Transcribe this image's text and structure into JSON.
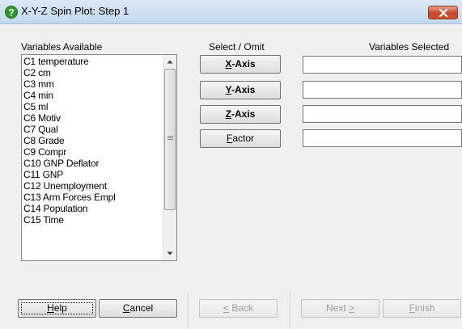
{
  "window": {
    "title": "X-Y-Z Spin Plot: Step 1",
    "icon": "help-question-icon",
    "close_icon": "close-icon"
  },
  "labels": {
    "variables_available": "Variables Available",
    "select_omit": "Select / Omit",
    "variables_selected": "Variables Selected"
  },
  "variables": [
    "C1 temperature",
    "C2 cm",
    "C3 mm",
    "C4 min",
    "C5 ml",
    "C6 Motiv",
    "C7 Qual",
    "C8 Grade",
    "C9 Compr",
    "C10 GNP Deflator",
    "C11 GNP",
    "C12 Unemployment",
    "C13 Arm Forces Empl",
    "C14 Population",
    "C15 Time"
  ],
  "axis_buttons": [
    {
      "mnemonic": "X",
      "rest": "-Axis",
      "selected_value": ""
    },
    {
      "mnemonic": "Y",
      "rest": "-Axis",
      "selected_value": ""
    },
    {
      "mnemonic": "Z",
      "rest": "-Axis",
      "selected_value": ""
    },
    {
      "mnemonic": "F",
      "rest": "actor",
      "selected_value": ""
    }
  ],
  "footer": {
    "help": {
      "mnemonic": "H",
      "rest": "elp"
    },
    "cancel": {
      "mnemonic": "C",
      "rest": "ancel"
    },
    "back": {
      "mnemonic": "<",
      "rest": " Back"
    },
    "next": {
      "pre": "Next ",
      "mnemonic": ">"
    },
    "finish": {
      "mnemonic": "F",
      "rest": "inish"
    }
  },
  "colors": {
    "accent_help_icon": "#2e9a2e",
    "close_button": "#c9462c",
    "disabled_text": "#a0a0a0"
  }
}
